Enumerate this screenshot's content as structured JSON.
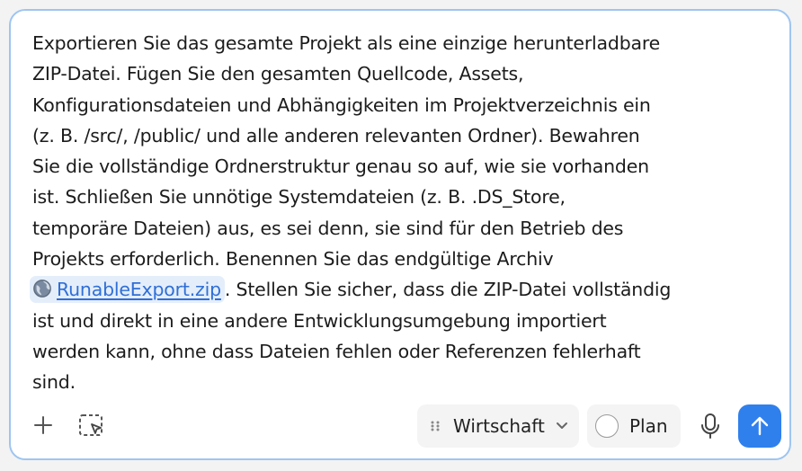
{
  "composer": {
    "message_lines": [
      "Exportieren Sie das gesamte Projekt als eine einzige herunterladbare",
      "ZIP-Datei. Fügen Sie den gesamten Quellcode, Assets,",
      "Konfigurationsdateien und Abhängigkeiten im Projektverzeichnis ein",
      "(z. B. /src/, /public/ und alle anderen relevanten Ordner). Bewahren",
      "Sie die vollständige Ordnerstruktur genau so auf, wie sie vorhanden",
      "ist. Schließen Sie unnötige Systemdateien (z. B. .DS_Store,",
      "temporäre Dateien) aus, es sei denn, sie sind für den Betrieb des",
      "Projekts erforderlich. Benennen Sie das endgültige Archiv"
    ],
    "file_link": {
      "icon": "globe-icon",
      "label": "RunableExport.zip"
    },
    "after_link_text": ". Stellen Sie sicher, dass die ZIP-Datei vollständig",
    "message_lines_after": [
      "ist und direkt in eine andere Entwicklungsumgebung importiert",
      "werden kann, ohne dass Dateien fehlen oder Referenzen fehlerhaft",
      "sind."
    ]
  },
  "toolbar": {
    "add_icon": "plus-icon",
    "select_icon": "selection-cursor-icon",
    "mode_select": {
      "icon": "grip-icon",
      "value": "Wirtschaft",
      "chevron": "chevron-down-icon"
    },
    "plan_toggle": {
      "label": "Plan",
      "checked": false
    },
    "mic_icon": "microphone-icon",
    "send_icon": "arrow-up-icon"
  },
  "colors": {
    "border": "#9ec5f0",
    "send_button": "#2f80ed",
    "link": "#2f6fd6",
    "chip_bg": "#e4eefb"
  }
}
